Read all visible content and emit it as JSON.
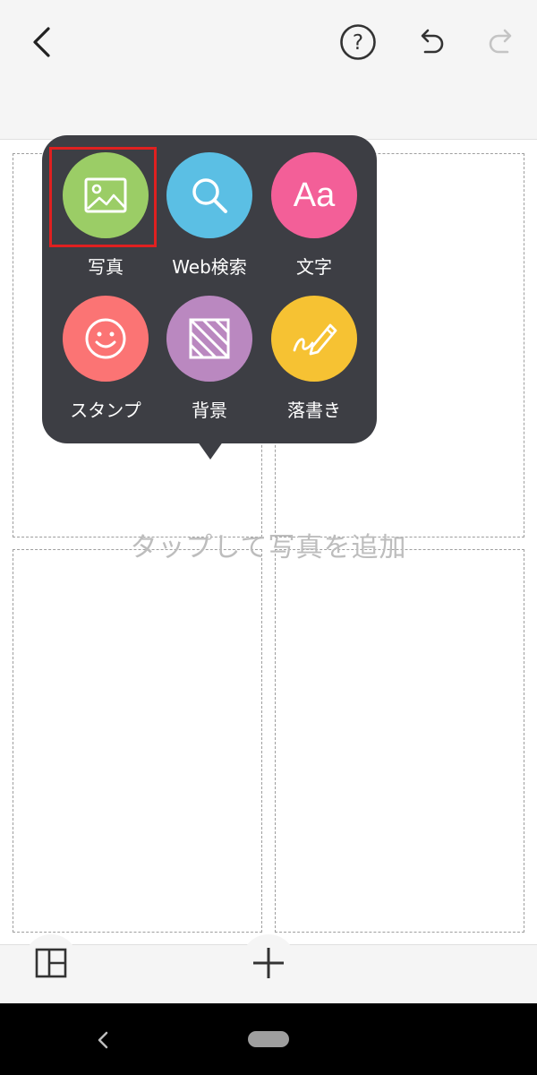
{
  "toolbar": {
    "back_icon": "chevron-left-icon",
    "help_icon": "question-circle-icon",
    "undo_icon": "undo-icon",
    "redo_icon": "redo-icon",
    "redo_disabled": true
  },
  "canvas": {
    "placeholder": "タップして写真を追加",
    "cell_count": 4
  },
  "menu": {
    "items": [
      {
        "label": "写真",
        "icon": "image-icon",
        "color": "#9bcd66",
        "selected": true
      },
      {
        "label": "Web検索",
        "icon": "search-icon",
        "color": "#5bbfe4"
      },
      {
        "label": "文字",
        "icon": "text-aa-icon",
        "glyph": "Aa",
        "color": "#f35f98"
      },
      {
        "label": "スタンプ",
        "icon": "smiley-icon",
        "color": "#fb7474"
      },
      {
        "label": "背景",
        "icon": "pattern-icon",
        "color": "#ba88c0"
      },
      {
        "label": "落書き",
        "icon": "pen-icon",
        "color": "#f6c233"
      }
    ]
  },
  "bottom": {
    "layout_icon": "layout-grid-icon",
    "add_icon": "plus-icon"
  },
  "system_nav": {
    "back_icon": "nav-back-icon",
    "home_icon": "home-pill-icon"
  },
  "colors": {
    "popup_bg": "#3d3e44",
    "highlight": "#e02020"
  }
}
